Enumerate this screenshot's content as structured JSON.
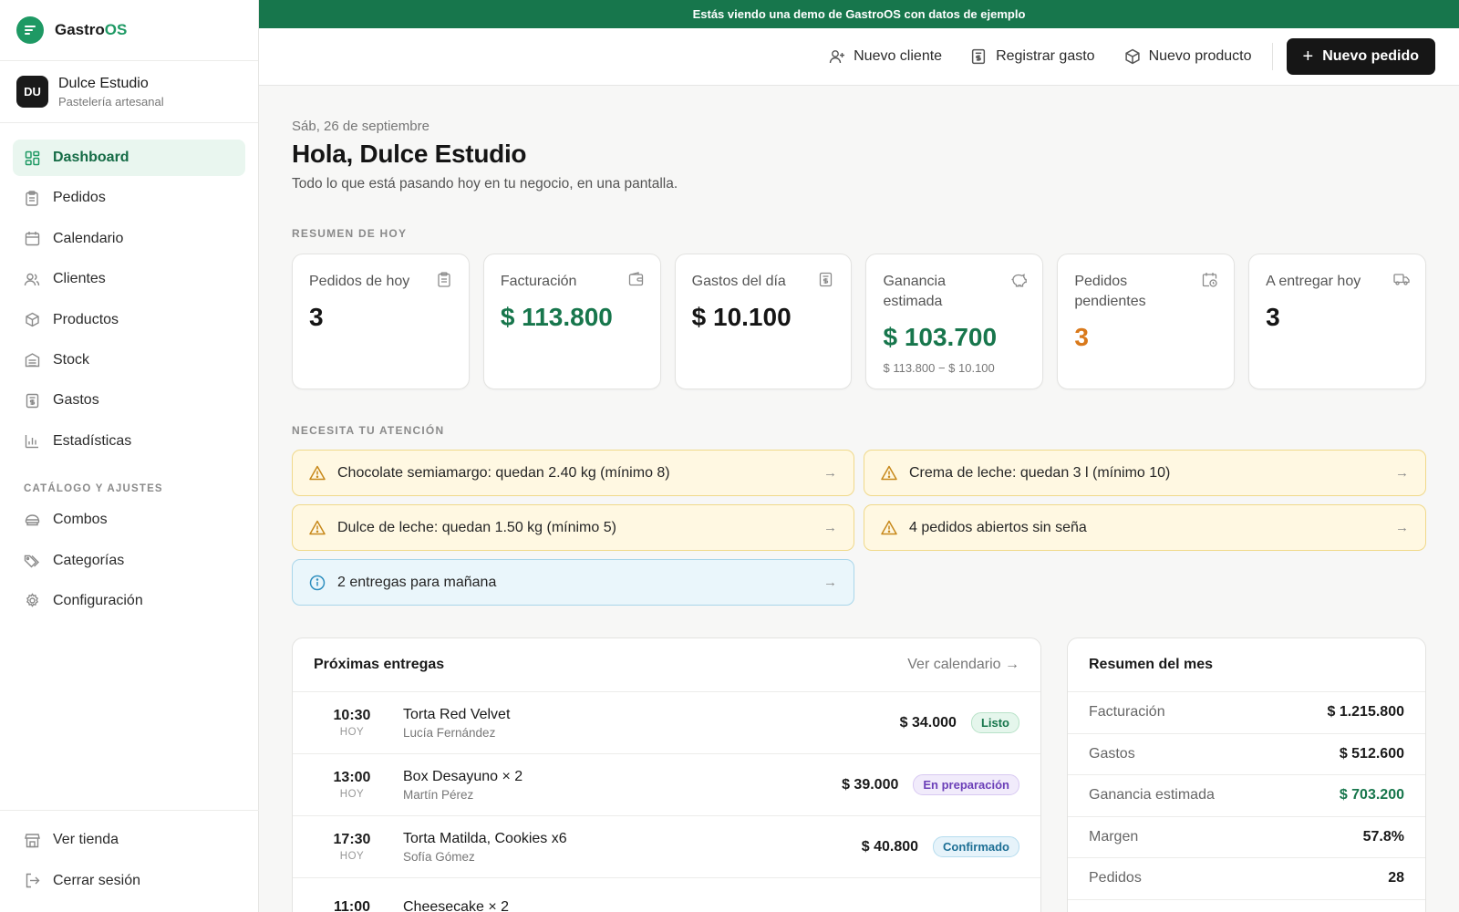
{
  "brand": {
    "name_prefix": "Gastro",
    "name_suffix": "OS"
  },
  "business": {
    "initials": "DU",
    "name": "Dulce Estudio",
    "subtitle": "Pastelería artesanal"
  },
  "nav": {
    "items": [
      {
        "label": "Dashboard",
        "icon": "dashboard-icon",
        "active": true
      },
      {
        "label": "Pedidos",
        "icon": "clipboard-icon"
      },
      {
        "label": "Calendario",
        "icon": "calendar-icon"
      },
      {
        "label": "Clientes",
        "icon": "users-icon"
      },
      {
        "label": "Productos",
        "icon": "box-icon"
      },
      {
        "label": "Stock",
        "icon": "warehouse-icon"
      },
      {
        "label": "Gastos",
        "icon": "receipt-icon"
      },
      {
        "label": "Estadísticas",
        "icon": "bar-chart-icon"
      }
    ],
    "section_label": "CATÁLOGO Y AJUSTES",
    "section_items": [
      {
        "label": "Combos",
        "icon": "combo-icon"
      },
      {
        "label": "Categorías",
        "icon": "tags-icon"
      },
      {
        "label": "Configuración",
        "icon": "gear-icon"
      }
    ],
    "bottom_items": [
      {
        "label": "Ver tienda",
        "icon": "store-icon"
      },
      {
        "label": "Cerrar sesión",
        "icon": "logout-icon"
      }
    ]
  },
  "banner": {
    "text": "Estás viendo una demo de GastroOS con datos de ejemplo"
  },
  "header": {
    "new_client": "Nuevo cliente",
    "register_expense": "Registrar gasto",
    "new_product": "Nuevo producto",
    "new_order": "Nuevo pedido"
  },
  "page": {
    "date": "Sáb, 26 de septiembre",
    "greeting": "Hola, Dulce Estudio",
    "subtitle": "Todo lo que está pasando hoy en tu negocio, en una pantalla."
  },
  "summary": {
    "label": "RESUMEN DE HOY",
    "cards": [
      {
        "label": "Pedidos de hoy",
        "value": "3",
        "icon": "clipboard-icon"
      },
      {
        "label": "Facturación",
        "value": "$ 113.800",
        "icon": "wallet-icon",
        "color": "#17764c"
      },
      {
        "label": "Gastos del día",
        "value": "$ 10.100",
        "icon": "receipt-icon"
      },
      {
        "label": "Ganancia estimada",
        "value": "$ 103.700",
        "note": "$ 113.800 − $ 10.100",
        "icon": "piggy-bank-icon",
        "color": "#17764c"
      },
      {
        "label": "Pedidos pendientes",
        "value": "3",
        "icon": "calendar-clock-icon",
        "color": "#d9791b"
      },
      {
        "label": "A entregar hoy",
        "value": "3",
        "icon": "truck-icon"
      }
    ]
  },
  "attention": {
    "label": "NECESITA TU ATENCIÓN",
    "alerts": [
      {
        "text": "Chocolate semiamargo: quedan 2.40 kg (mínimo 8)",
        "type": "warning"
      },
      {
        "text": "Crema de leche: quedan 3 l (mínimo 10)",
        "type": "warning"
      },
      {
        "text": "Dulce de leche: quedan 1.50 kg (mínimo 5)",
        "type": "warning"
      },
      {
        "text": "4 pedidos abiertos sin seña",
        "type": "warning"
      },
      {
        "text": "2 entregas para mañana",
        "type": "info"
      }
    ]
  },
  "deliveries": {
    "title": "Próximas entregas",
    "link": "Ver calendario",
    "rows": [
      {
        "time": "10:30",
        "day": "HOY",
        "product": "Torta Red Velvet",
        "client": "Lucía Fernández",
        "amount": "$ 34.000",
        "status": "Listo",
        "status_color": "#17764c"
      },
      {
        "time": "13:00",
        "day": "HOY",
        "product": "Box Desayuno × 2",
        "client": "Martín Pérez",
        "amount": "$ 39.000",
        "status": "En preparación",
        "status_color": "#6b3fb8"
      },
      {
        "time": "17:30",
        "day": "HOY",
        "product": "Torta Matilda, Cookies x6",
        "client": "Sofía Gómez",
        "amount": "$ 40.800",
        "status": "Confirmado",
        "status_color": "#1d6f95"
      },
      {
        "time": "11:00",
        "day": "",
        "product": "Cheesecake × 2",
        "client": "",
        "amount": "",
        "status": ""
      }
    ]
  },
  "month": {
    "title": "Resumen del mes",
    "rows": [
      {
        "label": "Facturación",
        "value": "$ 1.215.800"
      },
      {
        "label": "Gastos",
        "value": "$ 512.600"
      },
      {
        "label": "Ganancia estimada",
        "value": "$ 703.200",
        "color": "#17764c"
      },
      {
        "label": "Margen",
        "value": "57.8%"
      },
      {
        "label": "Pedidos",
        "value": "28"
      }
    ]
  }
}
